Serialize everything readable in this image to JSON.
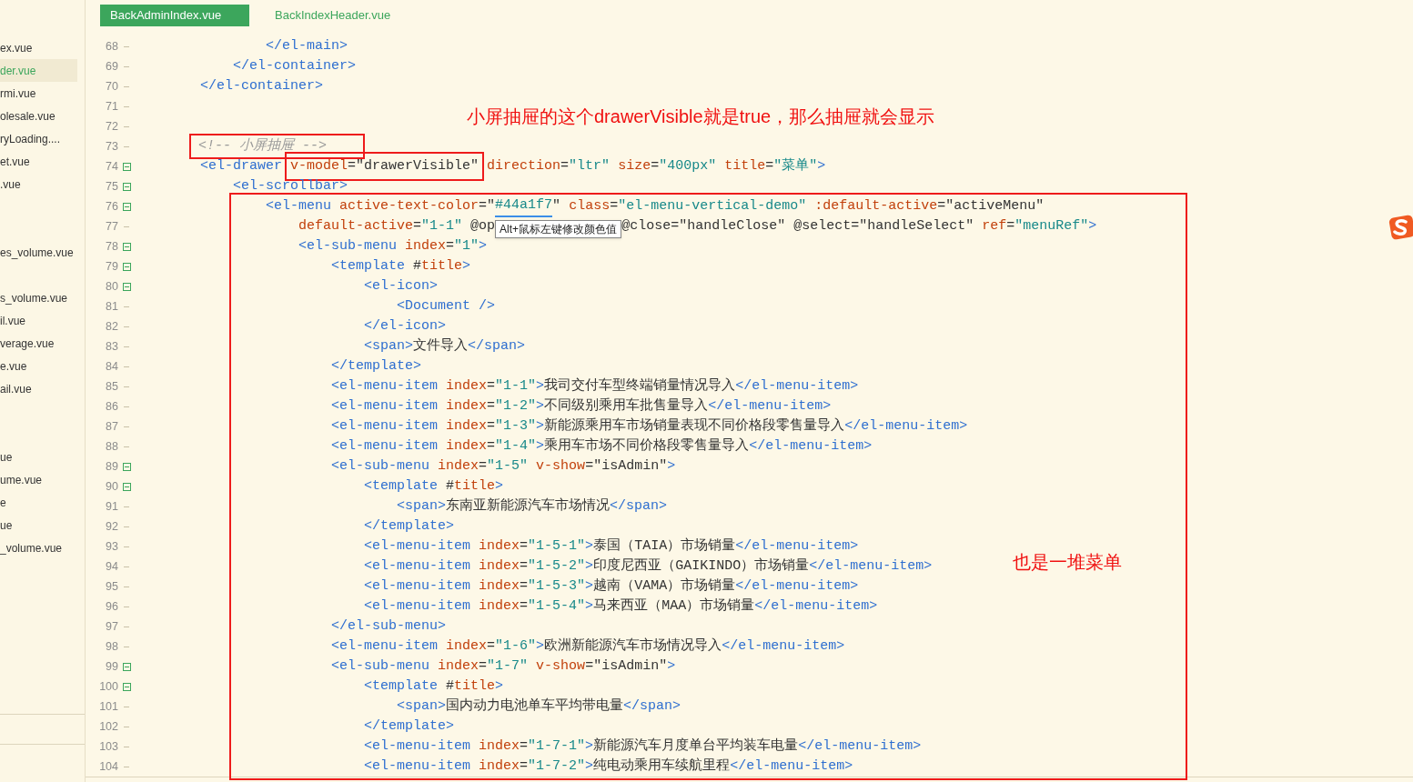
{
  "tabs": [
    {
      "label": "BackAdminIndex.vue",
      "selected": true
    },
    {
      "label": "BackIndexHeader.vue",
      "selected": false
    }
  ],
  "sidebar": {
    "items": [
      {
        "kind": "file",
        "label": "ex.vue",
        "selected": false
      },
      {
        "kind": "file",
        "label": "der.vue",
        "selected": true
      },
      {
        "kind": "file",
        "label": "rmi.vue",
        "selected": false
      },
      {
        "kind": "file",
        "label": "olesale.vue",
        "selected": false
      },
      {
        "kind": "file",
        "label": "ryLoading....",
        "selected": false
      },
      {
        "kind": "file",
        "label": "et.vue",
        "selected": false
      },
      {
        "kind": "file",
        "label": ".vue",
        "selected": false
      },
      {
        "kind": "blank"
      },
      {
        "kind": "blank"
      },
      {
        "kind": "file",
        "label": "es_volume.vue",
        "selected": false
      },
      {
        "kind": "blank"
      },
      {
        "kind": "file",
        "label": "s_volume.vue",
        "selected": false
      },
      {
        "kind": "file",
        "label": "il.vue",
        "selected": false
      },
      {
        "kind": "file",
        "label": "verage.vue",
        "selected": false
      },
      {
        "kind": "file",
        "label": "e.vue",
        "selected": false
      },
      {
        "kind": "file",
        "label": "ail.vue",
        "selected": false
      },
      {
        "kind": "blank"
      },
      {
        "kind": "blank"
      },
      {
        "kind": "file",
        "label": "ue",
        "selected": false
      },
      {
        "kind": "file",
        "label": "ume.vue",
        "selected": false
      },
      {
        "kind": "file",
        "label": "e",
        "selected": false
      },
      {
        "kind": "file",
        "label": "ue",
        "selected": false
      },
      {
        "kind": "file",
        "label": "_volume.vue",
        "selected": false
      }
    ]
  },
  "code": {
    "blocks": [
      {
        "boxed": false,
        "lines": [
          {
            "num": "68",
            "foldable": false,
            "tokens": [
              {
                "kind": "tag",
                "text": "                </el-main>"
              }
            ]
          },
          {
            "num": "69",
            "foldable": false,
            "tokens": [
              {
                "kind": "tag",
                "text": "            </el-container>"
              }
            ]
          },
          {
            "num": "70",
            "foldable": false,
            "tokens": [
              {
                "kind": "tag",
                "text": "        </el-container>"
              }
            ]
          },
          {
            "num": "71",
            "foldable": false
          },
          {
            "num": "72",
            "foldable": false
          },
          {
            "num": "73",
            "foldable": false,
            "segments": [
              {
                "boxed": true,
                "tokens": [
                  {
                    "kind": "comment",
                    "text": "        <!-- 小屏抽屉 -->"
                  }
                ]
              }
            ]
          },
          {
            "num": "74",
            "foldable": true,
            "segments": [
              {
                "boxed": false,
                "tokens": [
                  {
                    "kind": "tag",
                    "text": "        <el-drawer "
                  }
                ]
              },
              {
                "boxed": true,
                "tokens": [
                  {
                    "kind": "attr",
                    "text": "v-model"
                  },
                  {
                    "kind": "plain",
                    "text": "=\"drawerVisible\""
                  }
                ]
              },
              {
                "boxed": false,
                "tokens": [
                  {
                    "kind": "attr",
                    "text": " direction"
                  },
                  {
                    "kind": "plain",
                    "text": "="
                  },
                  {
                    "kind": "string",
                    "text": "\"ltr\""
                  },
                  {
                    "kind": "attr",
                    "text": " size"
                  },
                  {
                    "kind": "plain",
                    "text": "="
                  },
                  {
                    "kind": "string",
                    "text": "\"400px\""
                  },
                  {
                    "kind": "attr",
                    "text": " title"
                  },
                  {
                    "kind": "plain",
                    "text": "="
                  },
                  {
                    "kind": "string",
                    "text": "\"菜单\""
                  },
                  {
                    "kind": "tag",
                    "text": ">"
                  }
                ]
              }
            ]
          },
          {
            "num": "75",
            "foldable": true,
            "tokens": [
              {
                "kind": "tag",
                "text": "            <el-scrollbar>"
              }
            ]
          }
        ]
      },
      {
        "boxed": true,
        "lines": [
          {
            "num": "76",
            "foldable": true,
            "tokens": [
              {
                "kind": "tag",
                "text": "                <el-menu"
              },
              {
                "kind": "attr",
                "text": " active-text-color"
              },
              {
                "kind": "plain",
                "text": "=\""
              },
              {
                "kind": "color-value",
                "text": "#44a1f7"
              },
              {
                "kind": "plain",
                "text": "\""
              },
              {
                "kind": "attr",
                "text": " class"
              },
              {
                "kind": "plain",
                "text": "="
              },
              {
                "kind": "string",
                "text": "\"el-menu-vertical-demo\""
              },
              {
                "kind": "attr",
                "text": " :default-active"
              },
              {
                "kind": "plain",
                "text": "=\"activeMenu\""
              }
            ]
          },
          {
            "num": "77",
            "foldable": false,
            "tokens": [
              {
                "kind": "attr",
                "text": "                    default-active"
              },
              {
                "kind": "plain",
                "text": "="
              },
              {
                "kind": "string",
                "text": "\"1-1\""
              },
              {
                "kind": "plain",
                "text": " @op"
              },
              {
                "kind": "tooltip",
                "text": "Alt+鼠标左键修改颜色值"
              },
              {
                "kind": "plain",
                "text": "@close=\"handleClose\" @select=\"handleSelect\""
              },
              {
                "kind": "attr",
                "text": " ref"
              },
              {
                "kind": "plain",
                "text": "="
              },
              {
                "kind": "string",
                "text": "\"menuRef\""
              },
              {
                "kind": "tag",
                "text": ">"
              }
            ]
          },
          {
            "num": "78",
            "foldable": true,
            "tokens": [
              {
                "kind": "tag",
                "text": "                    <el-sub-menu"
              },
              {
                "kind": "attr",
                "text": " index"
              },
              {
                "kind": "plain",
                "text": "="
              },
              {
                "kind": "string",
                "text": "\"1\""
              },
              {
                "kind": "tag",
                "text": ">"
              }
            ]
          },
          {
            "num": "79",
            "foldable": true,
            "tokens": [
              {
                "kind": "tag",
                "text": "                        <template"
              },
              {
                "kind": "plain",
                "text": " #"
              },
              {
                "kind": "attr",
                "text": "title"
              },
              {
                "kind": "tag",
                "text": ">"
              }
            ]
          },
          {
            "num": "80",
            "foldable": true,
            "tokens": [
              {
                "kind": "tag",
                "text": "                            <el-icon>"
              }
            ]
          },
          {
            "num": "81",
            "foldable": false,
            "tokens": [
              {
                "kind": "tag",
                "text": "                                <Document />"
              }
            ]
          },
          {
            "num": "82",
            "foldable": false,
            "tokens": [
              {
                "kind": "tag",
                "text": "                            </el-icon>"
              }
            ]
          },
          {
            "num": "83",
            "foldable": false,
            "tokens": [
              {
                "kind": "tag",
                "text": "                            <span>"
              },
              {
                "kind": "plain",
                "text": "文件导入"
              },
              {
                "kind": "tag",
                "text": "</span>"
              }
            ]
          },
          {
            "num": "84",
            "foldable": false,
            "tokens": [
              {
                "kind": "tag",
                "text": "                        </template>"
              }
            ]
          },
          {
            "num": "85",
            "foldable": false,
            "tokens": [
              {
                "kind": "tag",
                "text": "                        <el-menu-item"
              },
              {
                "kind": "attr",
                "text": " index"
              },
              {
                "kind": "plain",
                "text": "="
              },
              {
                "kind": "string",
                "text": "\"1-1\""
              },
              {
                "kind": "tag",
                "text": ">"
              },
              {
                "kind": "plain",
                "text": "我司交付车型终端销量情况导入"
              },
              {
                "kind": "tag",
                "text": "</el-menu-item>"
              }
            ]
          },
          {
            "num": "86",
            "foldable": false,
            "tokens": [
              {
                "kind": "tag",
                "text": "                        <el-menu-item"
              },
              {
                "kind": "attr",
                "text": " index"
              },
              {
                "kind": "plain",
                "text": "="
              },
              {
                "kind": "string",
                "text": "\"1-2\""
              },
              {
                "kind": "tag",
                "text": ">"
              },
              {
                "kind": "plain",
                "text": "不同级别乘用车批售量导入"
              },
              {
                "kind": "tag",
                "text": "</el-menu-item>"
              }
            ]
          },
          {
            "num": "87",
            "foldable": false,
            "tokens": [
              {
                "kind": "tag",
                "text": "                        <el-menu-item"
              },
              {
                "kind": "attr",
                "text": " index"
              },
              {
                "kind": "plain",
                "text": "="
              },
              {
                "kind": "string",
                "text": "\"1-3\""
              },
              {
                "kind": "tag",
                "text": ">"
              },
              {
                "kind": "plain",
                "text": "新能源乘用车市场销量表现不同价格段零售量导入"
              },
              {
                "kind": "tag",
                "text": "</el-menu-item>"
              }
            ]
          },
          {
            "num": "88",
            "foldable": false,
            "tokens": [
              {
                "kind": "tag",
                "text": "                        <el-menu-item"
              },
              {
                "kind": "attr",
                "text": " index"
              },
              {
                "kind": "plain",
                "text": "="
              },
              {
                "kind": "string",
                "text": "\"1-4\""
              },
              {
                "kind": "tag",
                "text": ">"
              },
              {
                "kind": "plain",
                "text": "乘用车市场不同价格段零售量导入"
              },
              {
                "kind": "tag",
                "text": "</el-menu-item>"
              }
            ]
          },
          {
            "num": "89",
            "foldable": true,
            "tokens": [
              {
                "kind": "tag",
                "text": "                        <el-sub-menu"
              },
              {
                "kind": "attr",
                "text": " index"
              },
              {
                "kind": "plain",
                "text": "="
              },
              {
                "kind": "string",
                "text": "\"1-5\""
              },
              {
                "kind": "attr",
                "text": " v-show"
              },
              {
                "kind": "plain",
                "text": "=\"isAdmin\""
              },
              {
                "kind": "tag",
                "text": ">"
              }
            ]
          },
          {
            "num": "90",
            "foldable": true,
            "tokens": [
              {
                "kind": "tag",
                "text": "                            <template"
              },
              {
                "kind": "plain",
                "text": " #"
              },
              {
                "kind": "attr",
                "text": "title"
              },
              {
                "kind": "tag",
                "text": ">"
              }
            ]
          },
          {
            "num": "91",
            "foldable": false,
            "tokens": [
              {
                "kind": "tag",
                "text": "                                <span>"
              },
              {
                "kind": "plain",
                "text": "东南亚新能源汽车市场情况"
              },
              {
                "kind": "tag",
                "text": "</span>"
              }
            ]
          },
          {
            "num": "92",
            "foldable": false,
            "tokens": [
              {
                "kind": "tag",
                "text": "                            </template>"
              }
            ]
          },
          {
            "num": "93",
            "foldable": false,
            "tokens": [
              {
                "kind": "tag",
                "text": "                            <el-menu-item"
              },
              {
                "kind": "attr",
                "text": " index"
              },
              {
                "kind": "plain",
                "text": "="
              },
              {
                "kind": "string",
                "text": "\"1-5-1\""
              },
              {
                "kind": "tag",
                "text": ">"
              },
              {
                "kind": "plain",
                "text": "泰国（TAIA）市场销量"
              },
              {
                "kind": "tag",
                "text": "</el-menu-item>"
              }
            ]
          },
          {
            "num": "94",
            "foldable": false,
            "tokens": [
              {
                "kind": "tag",
                "text": "                            <el-menu-item"
              },
              {
                "kind": "attr",
                "text": " index"
              },
              {
                "kind": "plain",
                "text": "="
              },
              {
                "kind": "string",
                "text": "\"1-5-2\""
              },
              {
                "kind": "tag",
                "text": ">"
              },
              {
                "kind": "plain",
                "text": "印度尼西亚（GAIKINDO）市场销量"
              },
              {
                "kind": "tag",
                "text": "</el-menu-item>"
              }
            ]
          },
          {
            "num": "95",
            "foldable": false,
            "tokens": [
              {
                "kind": "tag",
                "text": "                            <el-menu-item"
              },
              {
                "kind": "attr",
                "text": " index"
              },
              {
                "kind": "plain",
                "text": "="
              },
              {
                "kind": "string",
                "text": "\"1-5-3\""
              },
              {
                "kind": "tag",
                "text": ">"
              },
              {
                "kind": "plain",
                "text": "越南（VAMA）市场销量"
              },
              {
                "kind": "tag",
                "text": "</el-menu-item>"
              }
            ]
          },
          {
            "num": "96",
            "foldable": false,
            "tokens": [
              {
                "kind": "tag",
                "text": "                            <el-menu-item"
              },
              {
                "kind": "attr",
                "text": " index"
              },
              {
                "kind": "plain",
                "text": "="
              },
              {
                "kind": "string",
                "text": "\"1-5-4\""
              },
              {
                "kind": "tag",
                "text": ">"
              },
              {
                "kind": "plain",
                "text": "马来西亚（MAA）市场销量"
              },
              {
                "kind": "tag",
                "text": "</el-menu-item>"
              }
            ]
          },
          {
            "num": "97",
            "foldable": false,
            "tokens": [
              {
                "kind": "tag",
                "text": "                        </el-sub-menu>"
              }
            ]
          },
          {
            "num": "98",
            "foldable": false,
            "tokens": [
              {
                "kind": "tag",
                "text": "                        <el-menu-item"
              },
              {
                "kind": "attr",
                "text": " index"
              },
              {
                "kind": "plain",
                "text": "="
              },
              {
                "kind": "string",
                "text": "\"1-6\""
              },
              {
                "kind": "tag",
                "text": ">"
              },
              {
                "kind": "plain",
                "text": "欧洲新能源汽车市场情况导入"
              },
              {
                "kind": "tag",
                "text": "</el-menu-item>"
              }
            ]
          },
          {
            "num": "99",
            "foldable": true,
            "tokens": [
              {
                "kind": "tag",
                "text": "                        <el-sub-menu"
              },
              {
                "kind": "attr",
                "text": " index"
              },
              {
                "kind": "plain",
                "text": "="
              },
              {
                "kind": "string",
                "text": "\"1-7\""
              },
              {
                "kind": "attr",
                "text": " v-show"
              },
              {
                "kind": "plain",
                "text": "=\"isAdmin\""
              },
              {
                "kind": "tag",
                "text": ">"
              }
            ]
          },
          {
            "num": "100",
            "foldable": true,
            "tokens": [
              {
                "kind": "tag",
                "text": "                            <template"
              },
              {
                "kind": "plain",
                "text": " #"
              },
              {
                "kind": "attr",
                "text": "title"
              },
              {
                "kind": "tag",
                "text": ">"
              }
            ]
          },
          {
            "num": "101",
            "foldable": false,
            "tokens": [
              {
                "kind": "tag",
                "text": "                                <span>"
              },
              {
                "kind": "plain",
                "text": "国内动力电池单车平均带电量"
              },
              {
                "kind": "tag",
                "text": "</span>"
              }
            ]
          },
          {
            "num": "102",
            "foldable": false,
            "tokens": [
              {
                "kind": "tag",
                "text": "                            </template>"
              }
            ]
          },
          {
            "num": "103",
            "foldable": false,
            "tokens": [
              {
                "kind": "tag",
                "text": "                            <el-menu-item"
              },
              {
                "kind": "attr",
                "text": " index"
              },
              {
                "kind": "plain",
                "text": "="
              },
              {
                "kind": "string",
                "text": "\"1-7-1\""
              },
              {
                "kind": "tag",
                "text": ">"
              },
              {
                "kind": "plain",
                "text": "新能源汽车月度单台平均装车电量"
              },
              {
                "kind": "tag",
                "text": "</el-menu-item>"
              }
            ]
          },
          {
            "num": "104",
            "foldable": false,
            "tokens": [
              {
                "kind": "tag",
                "text": "                            <el-menu-item"
              },
              {
                "kind": "attr",
                "text": " index"
              },
              {
                "kind": "plain",
                "text": "="
              },
              {
                "kind": "string",
                "text": "\"1-7-2\""
              },
              {
                "kind": "tag",
                "text": ">"
              },
              {
                "kind": "plain",
                "text": "纯电动乘用车续航里程"
              },
              {
                "kind": "tag",
                "text": "</el-menu-item>"
              }
            ]
          }
        ]
      }
    ]
  },
  "annotations": [
    {
      "text": "小屏抽屉的这个drawerVisible就是true，那么抽屉就会显示"
    },
    {
      "text": "也是一堆菜单"
    }
  ]
}
